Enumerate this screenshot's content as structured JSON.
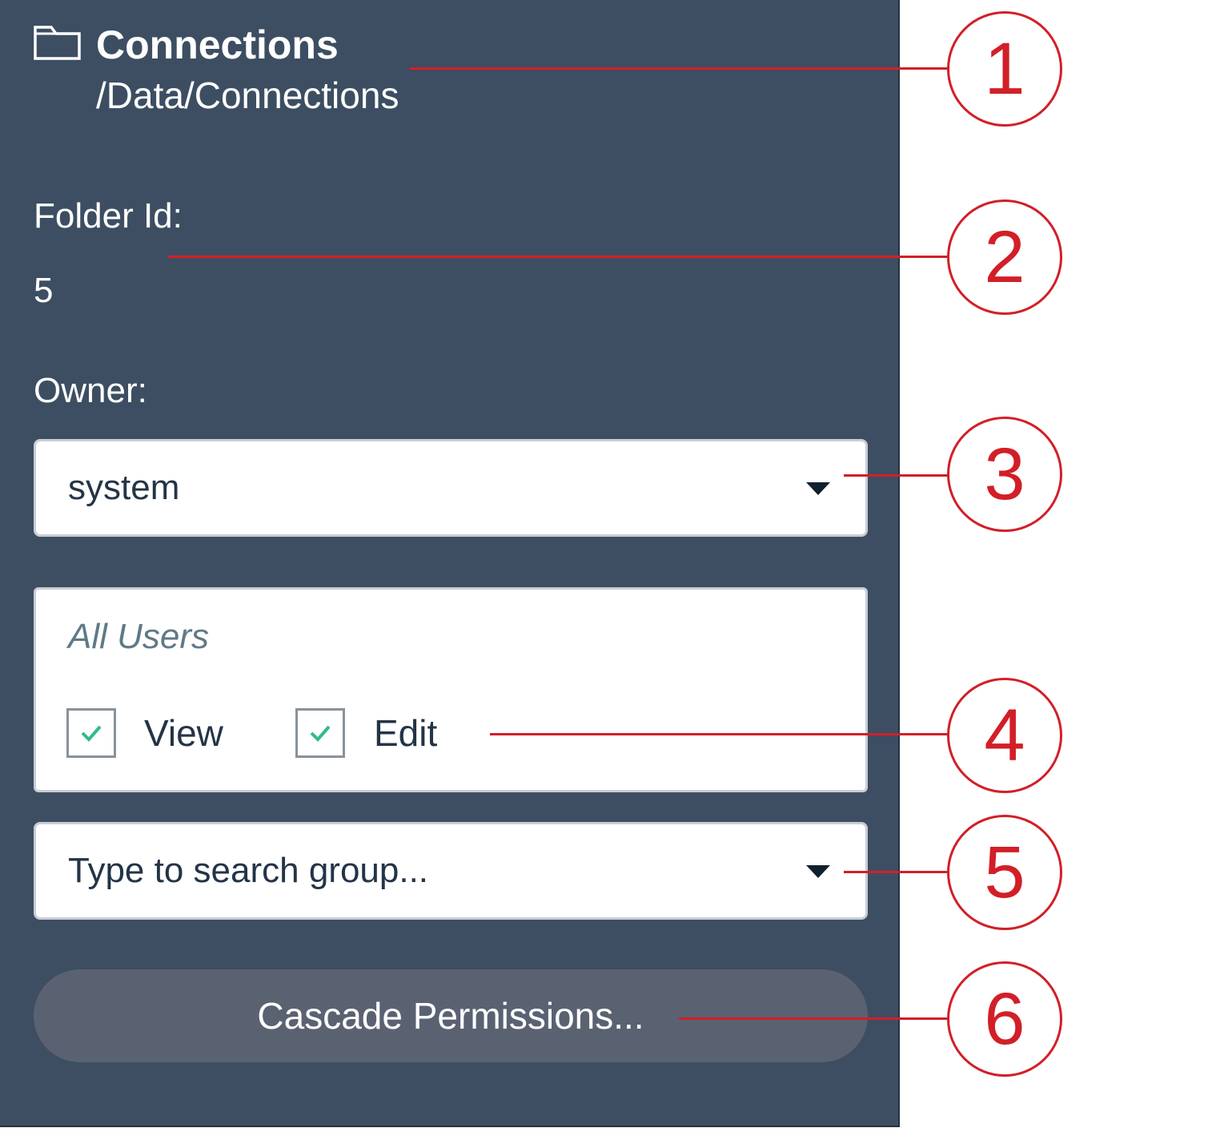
{
  "header": {
    "title": "Connections",
    "path": "/Data/Connections"
  },
  "folder_id": {
    "label": "Folder Id:",
    "value": "5"
  },
  "owner": {
    "label": "Owner:",
    "selected": "system"
  },
  "permissions": {
    "group": "All Users",
    "view_label": "View",
    "edit_label": "Edit",
    "view_checked": true,
    "edit_checked": true
  },
  "group_search": {
    "placeholder": "Type to search group..."
  },
  "cascade_button": {
    "label": "Cascade Permissions..."
  },
  "callouts": [
    "1",
    "2",
    "3",
    "4",
    "5",
    "6"
  ],
  "colors": {
    "panel": "#3d4e62",
    "callout": "#d21f27",
    "check": "#2ebd88",
    "button": "#5a6272"
  },
  "icons": {
    "folder": "folder-icon",
    "dropdown": "caret-down-icon",
    "check": "checkmark-icon"
  }
}
